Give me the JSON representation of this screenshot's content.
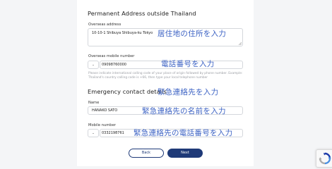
{
  "permanent_address": {
    "title": "Permanent Address outside Thailand",
    "overseas_address_label": "Overseas address",
    "overseas_address_value": "10-10-1 Shibuya Shibuya-ku Tokyo",
    "overseas_address_note": "居住地の住所を入力",
    "mobile_label": "Overseas mobile number",
    "mobile_code": "-",
    "mobile_value": "09098760000",
    "mobile_note": "電話番号を入力",
    "mobile_hint": "Please indicate international calling code of your place of origin followed by phone number. Example: Thailand's country calling code is +66, then type your local telephone number"
  },
  "emergency": {
    "title": "Emergency contact details",
    "title_note": "緊急連絡先を入力",
    "name_label": "Name",
    "name_value": "HANAKO SATO",
    "name_note": "緊急連絡先の名前を入力",
    "mobile_label": "Mobile number",
    "mobile_code": "-",
    "mobile_value": "0332198761",
    "mobile_note": "緊急連絡先の電話番号を入力"
  },
  "buttons": {
    "back_label": "Back",
    "next_label": "Next"
  },
  "colors": {
    "annotation": "#3d63c4",
    "primary": "#1f3a78",
    "background": "#f4f5f7"
  }
}
